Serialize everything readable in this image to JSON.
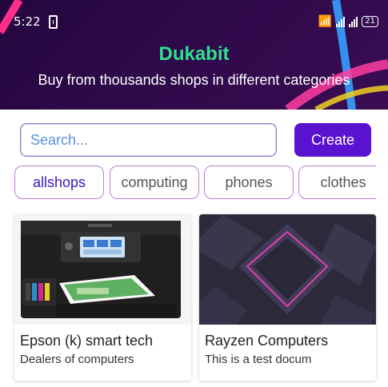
{
  "status_bar": {
    "time": "5:22",
    "battery_level": "21"
  },
  "header": {
    "title": "Dukabit",
    "subtitle": "Buy from thousands shops in different categories"
  },
  "search": {
    "placeholder": "Search..."
  },
  "create_label": "Create",
  "categories": [
    {
      "label": "allshops",
      "active": true
    },
    {
      "label": "computing",
      "active": false
    },
    {
      "label": "phones",
      "active": false
    },
    {
      "label": "clothes",
      "active": false
    }
  ],
  "shops": [
    {
      "name": "Epson (k) smart tech",
      "description": "Dealers of computers"
    },
    {
      "name": "Rayzen Computers",
      "description": "This is a test docum"
    }
  ],
  "colors": {
    "header_bg": "#2e0a4a",
    "accent_title": "#2ee08a",
    "primary": "#5a12d0",
    "chip_border": "#c07ad8"
  }
}
